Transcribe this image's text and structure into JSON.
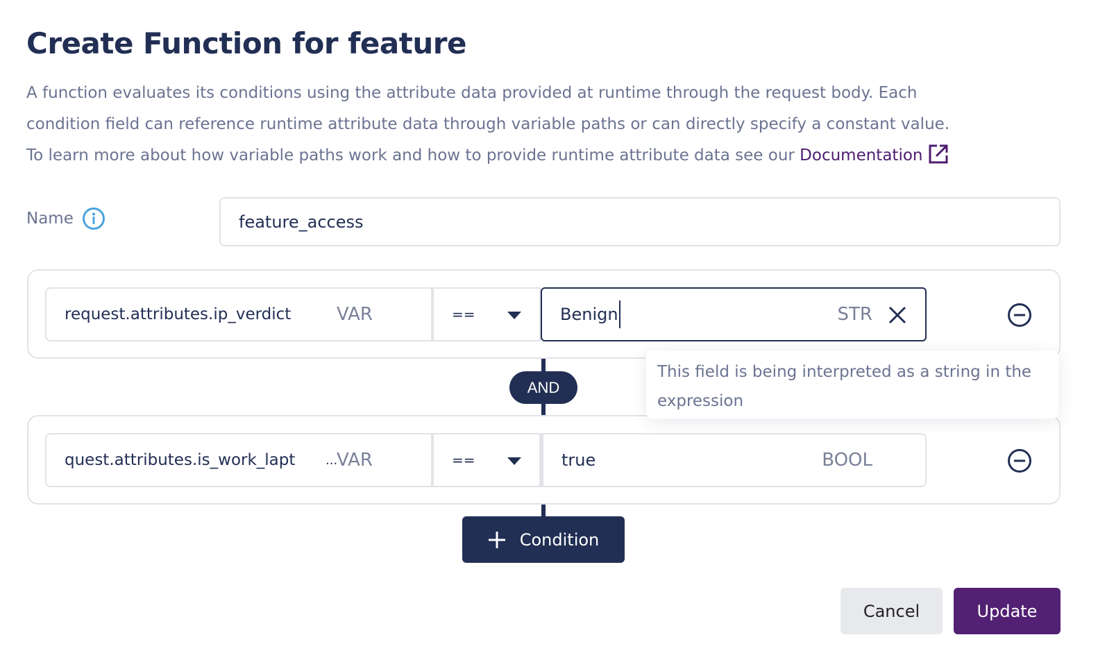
{
  "header": {
    "title": "Create Function for feature",
    "description_lines": [
      "A function evaluates its conditions using the attribute data provided at runtime through the request body. Each",
      "condition field can reference runtime attribute data through variable paths or can directly specify a constant value.",
      "To learn more about how variable paths work and how to provide runtime attribute data see our "
    ],
    "doc_link_label": "Documentation",
    "doc_link_icon": "external-link-icon"
  },
  "name_field": {
    "label": "Name",
    "info_icon": "info-icon",
    "value": "feature_access"
  },
  "conditions": [
    {
      "lhs_value": "request.attributes.ip_verdict",
      "lhs_truncated": false,
      "lhs_type": "VAR",
      "operator": "==",
      "rhs_value": "Benign",
      "rhs_type": "STR",
      "rhs_focused": true
    },
    {
      "lhs_value": "quest.attributes.is_work_lapt",
      "lhs_truncated": true,
      "lhs_ellipsis": "...",
      "lhs_type": "VAR",
      "operator": "==",
      "rhs_value": "true",
      "rhs_type": "BOOL",
      "rhs_focused": false
    }
  ],
  "joiner": "AND",
  "tooltip": {
    "text": "This field is being interpreted as a string in the expression"
  },
  "add_condition_label": "Condition",
  "footer": {
    "cancel_label": "Cancel",
    "update_label": "Update"
  },
  "colors": {
    "primary_navy": "#222f54",
    "accent_purple": "#522173",
    "link_purple": "#4e1c6f",
    "muted_text": "#6b7391",
    "info_blue": "#4aa3df",
    "border": "#e2e3e8"
  }
}
